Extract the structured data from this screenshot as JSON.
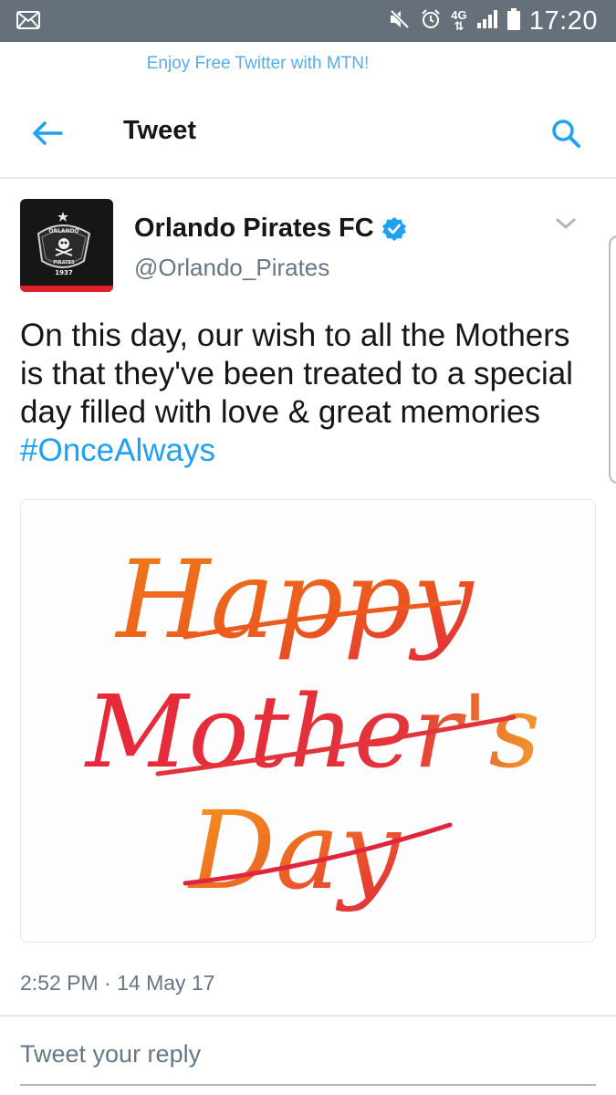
{
  "status_bar": {
    "time": "17:20",
    "network": "4G",
    "icons": [
      "notification-icon",
      "mute-icon",
      "alarm-icon",
      "network-4g-icon",
      "signal-icon",
      "battery-icon"
    ]
  },
  "promo": {
    "text": "Enjoy Free Twitter with MTN!"
  },
  "header": {
    "title": "Tweet",
    "icons": [
      "back-arrow-icon",
      "search-icon"
    ]
  },
  "tweet": {
    "author": {
      "display_name": "Orlando Pirates FC",
      "handle": "@Orlando_Pirates",
      "verified": true,
      "avatar_text_top": "ORLANDO",
      "avatar_text_bottom": "PIRATES",
      "avatar_year": "1937"
    },
    "text": "On this day, our wish to all the Mothers is that they've been treated to a special day filled with love & great memories",
    "hashtag": "#OnceAlways",
    "image": {
      "line1": "Happy",
      "line2": "Mother's",
      "line3": "Day"
    },
    "timestamp": "2:52 PM · 14 May 17"
  },
  "reply": {
    "placeholder": "Tweet your reply"
  },
  "colors": {
    "status_bar": "#66707a",
    "accent": "#1da1f2",
    "promo_text": "#55acee",
    "secondary_text": "#657786",
    "divider": "#e1e8ed"
  }
}
